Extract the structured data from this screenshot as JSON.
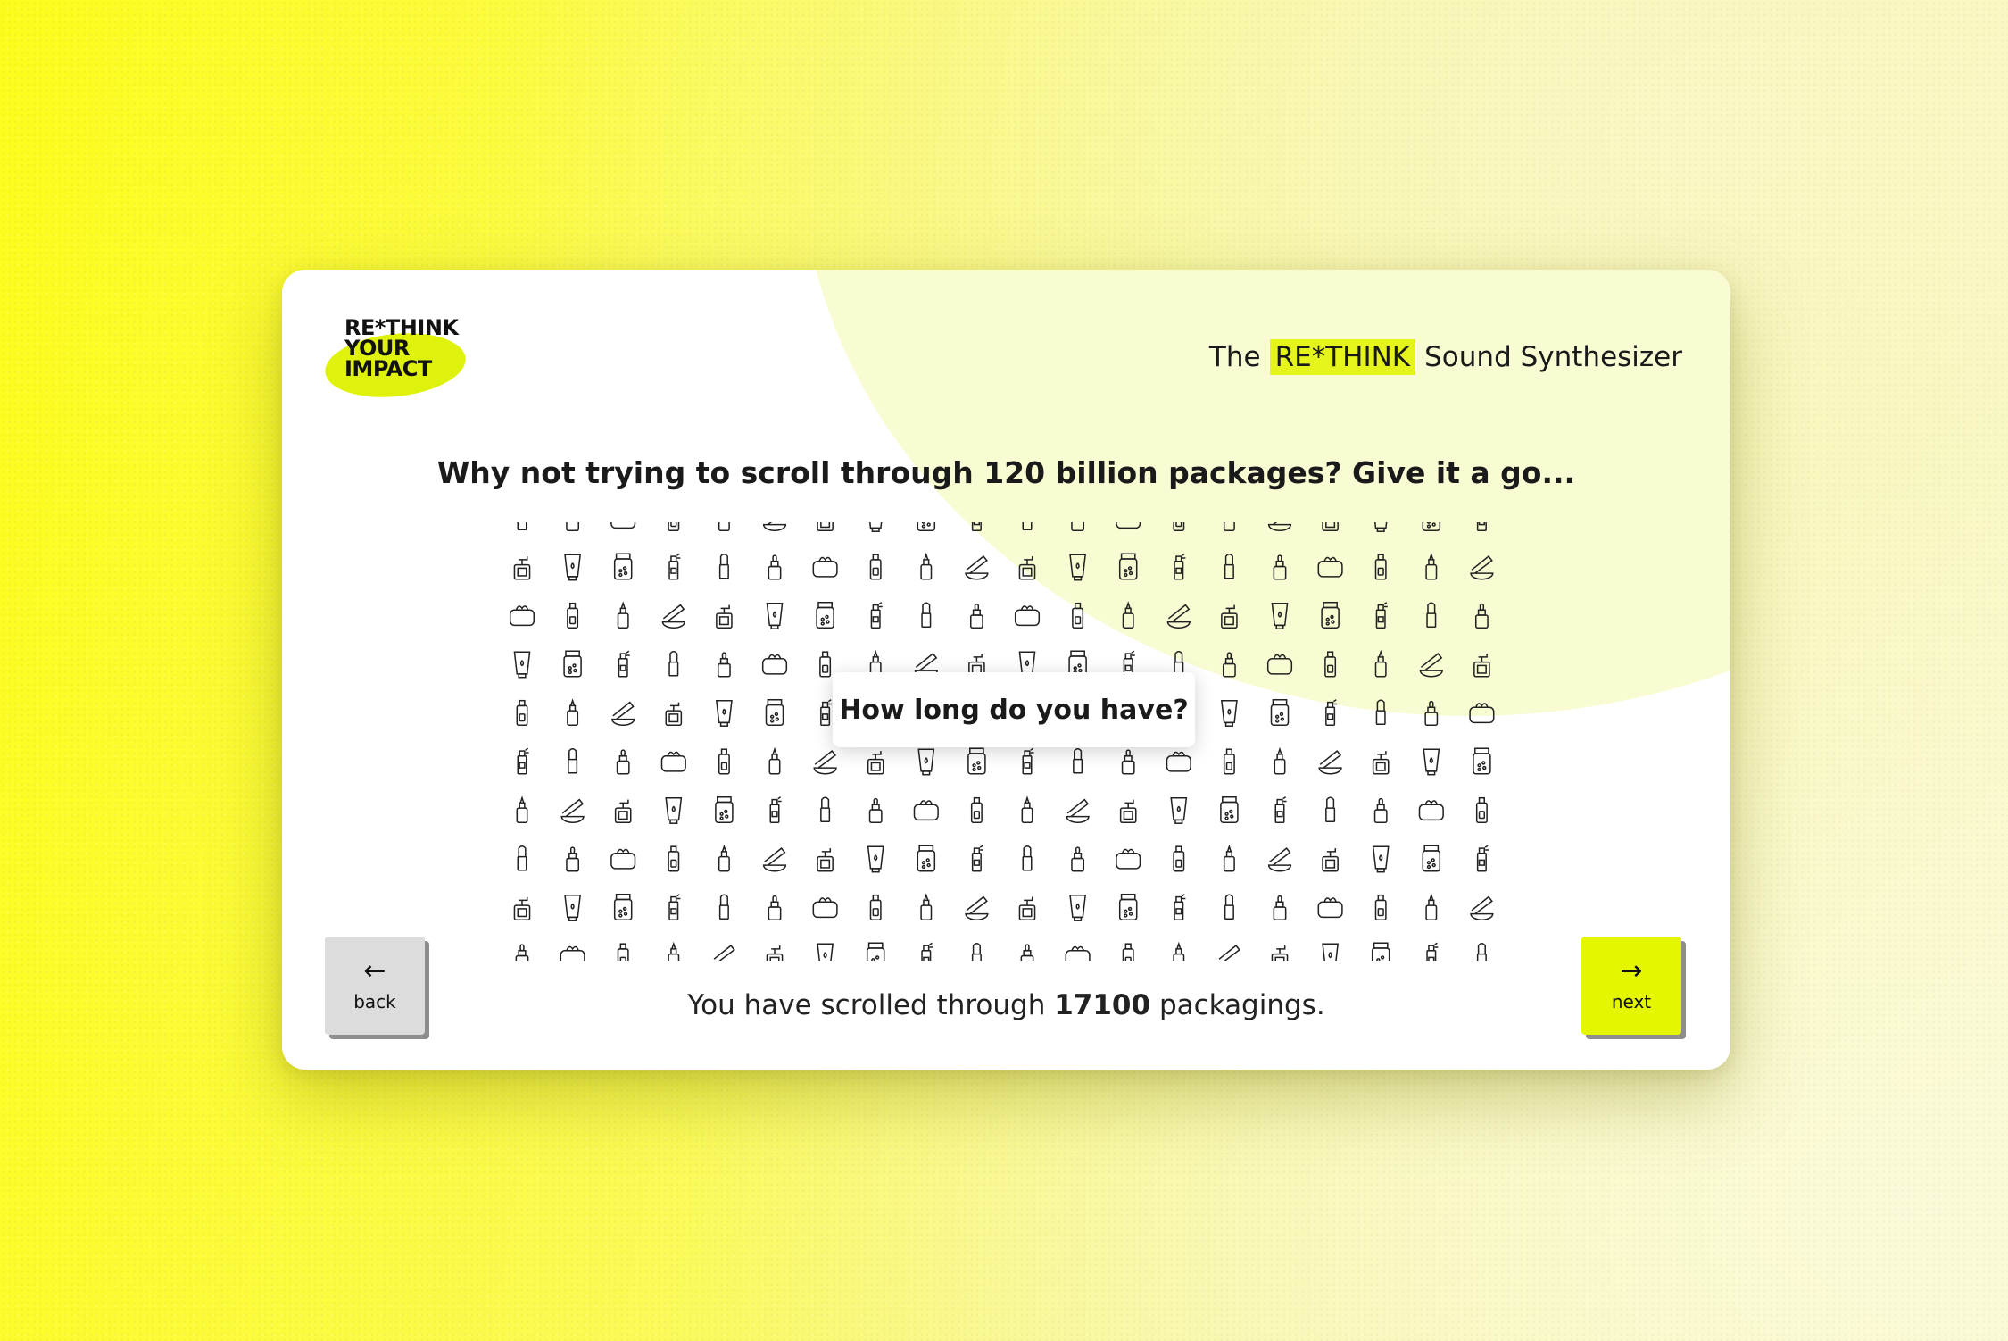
{
  "brand": {
    "logo_lines": [
      "RE*THINK",
      "YOUR",
      "IMPACT"
    ],
    "accent": "#e5f51c"
  },
  "header": {
    "title_prefix": "The",
    "title_highlight": "RE*THINK",
    "title_suffix": "Sound Synthesizer"
  },
  "question": "Why not trying to scroll through 120 billion packages? Give it a go...",
  "popup": "How long do you have?",
  "grid": {
    "icon_types": [
      "lipstick",
      "tube",
      "bottle",
      "dropper",
      "jar",
      "compact",
      "wipes",
      "spray",
      "pump",
      "serum"
    ]
  },
  "status": {
    "prefix": "You have scrolled through",
    "count": "17100",
    "suffix": "packagings."
  },
  "nav": {
    "back_label": "back",
    "back_arrow": "←",
    "next_label": "next",
    "next_arrow": "→"
  }
}
